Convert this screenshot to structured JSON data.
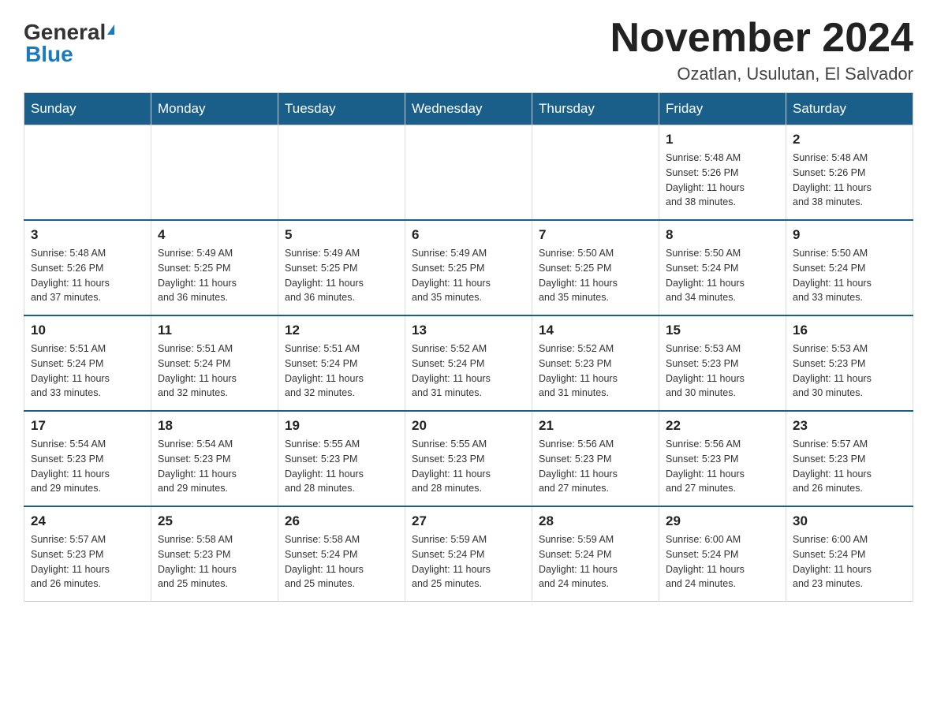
{
  "logo": {
    "general": "General",
    "blue": "Blue",
    "triangle": "▲"
  },
  "header": {
    "month_title": "November 2024",
    "location": "Ozatlan, Usulutan, El Salvador"
  },
  "weekdays": [
    "Sunday",
    "Monday",
    "Tuesday",
    "Wednesday",
    "Thursday",
    "Friday",
    "Saturday"
  ],
  "weeks": [
    [
      {
        "day": "",
        "info": ""
      },
      {
        "day": "",
        "info": ""
      },
      {
        "day": "",
        "info": ""
      },
      {
        "day": "",
        "info": ""
      },
      {
        "day": "",
        "info": ""
      },
      {
        "day": "1",
        "info": "Sunrise: 5:48 AM\nSunset: 5:26 PM\nDaylight: 11 hours\nand 38 minutes."
      },
      {
        "day": "2",
        "info": "Sunrise: 5:48 AM\nSunset: 5:26 PM\nDaylight: 11 hours\nand 38 minutes."
      }
    ],
    [
      {
        "day": "3",
        "info": "Sunrise: 5:48 AM\nSunset: 5:26 PM\nDaylight: 11 hours\nand 37 minutes."
      },
      {
        "day": "4",
        "info": "Sunrise: 5:49 AM\nSunset: 5:25 PM\nDaylight: 11 hours\nand 36 minutes."
      },
      {
        "day": "5",
        "info": "Sunrise: 5:49 AM\nSunset: 5:25 PM\nDaylight: 11 hours\nand 36 minutes."
      },
      {
        "day": "6",
        "info": "Sunrise: 5:49 AM\nSunset: 5:25 PM\nDaylight: 11 hours\nand 35 minutes."
      },
      {
        "day": "7",
        "info": "Sunrise: 5:50 AM\nSunset: 5:25 PM\nDaylight: 11 hours\nand 35 minutes."
      },
      {
        "day": "8",
        "info": "Sunrise: 5:50 AM\nSunset: 5:24 PM\nDaylight: 11 hours\nand 34 minutes."
      },
      {
        "day": "9",
        "info": "Sunrise: 5:50 AM\nSunset: 5:24 PM\nDaylight: 11 hours\nand 33 minutes."
      }
    ],
    [
      {
        "day": "10",
        "info": "Sunrise: 5:51 AM\nSunset: 5:24 PM\nDaylight: 11 hours\nand 33 minutes."
      },
      {
        "day": "11",
        "info": "Sunrise: 5:51 AM\nSunset: 5:24 PM\nDaylight: 11 hours\nand 32 minutes."
      },
      {
        "day": "12",
        "info": "Sunrise: 5:51 AM\nSunset: 5:24 PM\nDaylight: 11 hours\nand 32 minutes."
      },
      {
        "day": "13",
        "info": "Sunrise: 5:52 AM\nSunset: 5:24 PM\nDaylight: 11 hours\nand 31 minutes."
      },
      {
        "day": "14",
        "info": "Sunrise: 5:52 AM\nSunset: 5:23 PM\nDaylight: 11 hours\nand 31 minutes."
      },
      {
        "day": "15",
        "info": "Sunrise: 5:53 AM\nSunset: 5:23 PM\nDaylight: 11 hours\nand 30 minutes."
      },
      {
        "day": "16",
        "info": "Sunrise: 5:53 AM\nSunset: 5:23 PM\nDaylight: 11 hours\nand 30 minutes."
      }
    ],
    [
      {
        "day": "17",
        "info": "Sunrise: 5:54 AM\nSunset: 5:23 PM\nDaylight: 11 hours\nand 29 minutes."
      },
      {
        "day": "18",
        "info": "Sunrise: 5:54 AM\nSunset: 5:23 PM\nDaylight: 11 hours\nand 29 minutes."
      },
      {
        "day": "19",
        "info": "Sunrise: 5:55 AM\nSunset: 5:23 PM\nDaylight: 11 hours\nand 28 minutes."
      },
      {
        "day": "20",
        "info": "Sunrise: 5:55 AM\nSunset: 5:23 PM\nDaylight: 11 hours\nand 28 minutes."
      },
      {
        "day": "21",
        "info": "Sunrise: 5:56 AM\nSunset: 5:23 PM\nDaylight: 11 hours\nand 27 minutes."
      },
      {
        "day": "22",
        "info": "Sunrise: 5:56 AM\nSunset: 5:23 PM\nDaylight: 11 hours\nand 27 minutes."
      },
      {
        "day": "23",
        "info": "Sunrise: 5:57 AM\nSunset: 5:23 PM\nDaylight: 11 hours\nand 26 minutes."
      }
    ],
    [
      {
        "day": "24",
        "info": "Sunrise: 5:57 AM\nSunset: 5:23 PM\nDaylight: 11 hours\nand 26 minutes."
      },
      {
        "day": "25",
        "info": "Sunrise: 5:58 AM\nSunset: 5:23 PM\nDaylight: 11 hours\nand 25 minutes."
      },
      {
        "day": "26",
        "info": "Sunrise: 5:58 AM\nSunset: 5:24 PM\nDaylight: 11 hours\nand 25 minutes."
      },
      {
        "day": "27",
        "info": "Sunrise: 5:59 AM\nSunset: 5:24 PM\nDaylight: 11 hours\nand 25 minutes."
      },
      {
        "day": "28",
        "info": "Sunrise: 5:59 AM\nSunset: 5:24 PM\nDaylight: 11 hours\nand 24 minutes."
      },
      {
        "day": "29",
        "info": "Sunrise: 6:00 AM\nSunset: 5:24 PM\nDaylight: 11 hours\nand 24 minutes."
      },
      {
        "day": "30",
        "info": "Sunrise: 6:00 AM\nSunset: 5:24 PM\nDaylight: 11 hours\nand 23 minutes."
      }
    ]
  ]
}
